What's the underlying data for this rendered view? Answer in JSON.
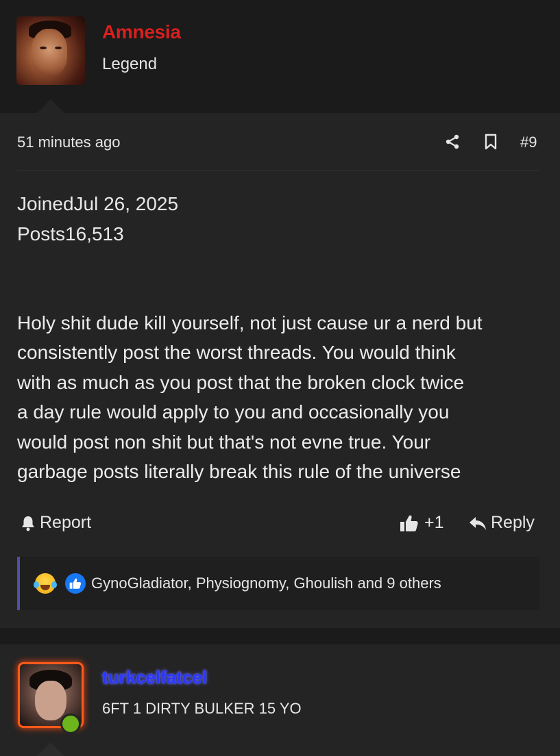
{
  "post_author": {
    "username": "Amnesia",
    "user_title": "Legend",
    "username_color": "#d8201f"
  },
  "post": {
    "time": "51 minutes ago",
    "share_icon": "share-icon",
    "bookmark_icon": "bookmark-icon",
    "number": "#9",
    "joined_line": "JoinedJul 26, 2025",
    "posts_line": "Posts16,513",
    "body": "Holy shit dude kill yourself, not just cause ur a nerd but\nconsistently post the worst threads. You would think\nwith as much as you post that the broken clock twice\na day rule would apply to you and occasionally you\nwould post non shit but that's not evne true. Your\ngarbage posts literally break this rule of the universe",
    "report_label": "Report",
    "like_count": "+1",
    "reply_label": "Reply",
    "reactions_text": "GynoGladiator, Physiognomy, Ghoulish and 9 others",
    "reaction_icons": [
      "laughing-crying-emoji",
      "thumbs-up-reaction"
    ]
  },
  "next_user": {
    "username": "turkcelfatcel",
    "user_title": "6FT 1 DIRTY BULKER 15 YO",
    "username_color": "#2a35ff",
    "online_status_color": "#6cb51c"
  }
}
